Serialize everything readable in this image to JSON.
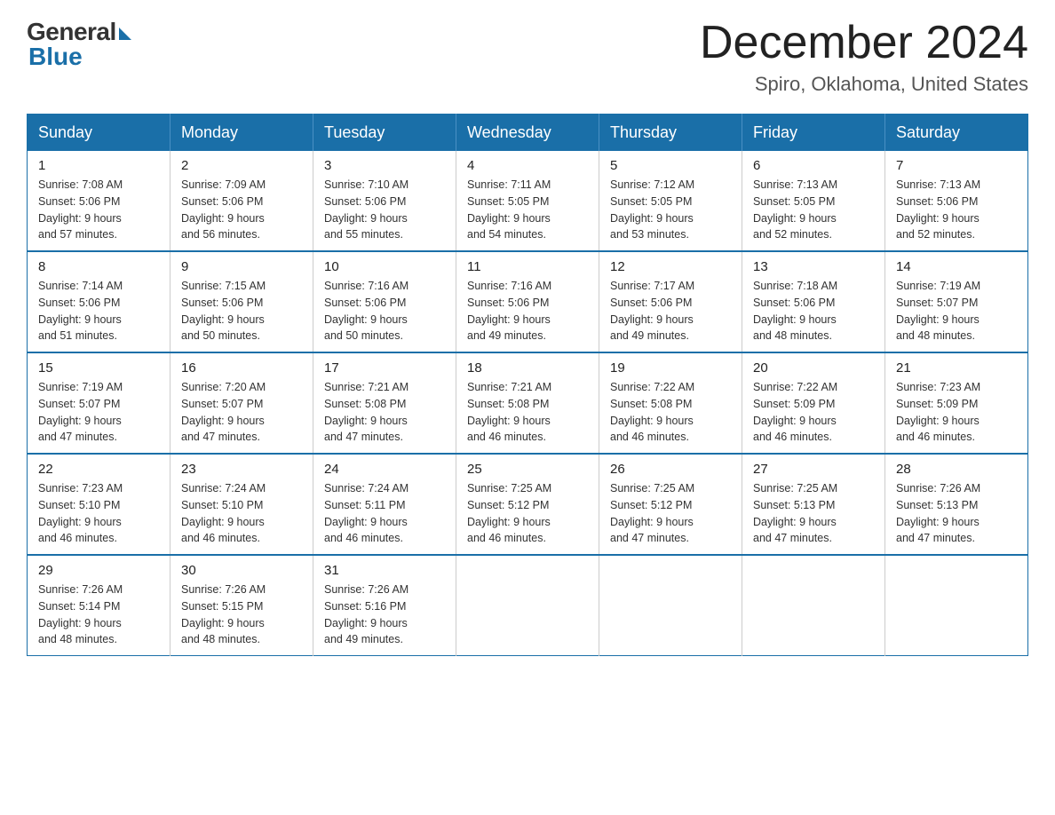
{
  "logo": {
    "general": "General",
    "blue": "Blue"
  },
  "title": {
    "month_year": "December 2024",
    "location": "Spiro, Oklahoma, United States"
  },
  "weekdays": [
    "Sunday",
    "Monday",
    "Tuesday",
    "Wednesday",
    "Thursday",
    "Friday",
    "Saturday"
  ],
  "weeks": [
    [
      {
        "day": "1",
        "sunrise": "7:08 AM",
        "sunset": "5:06 PM",
        "daylight": "9 hours and 57 minutes."
      },
      {
        "day": "2",
        "sunrise": "7:09 AM",
        "sunset": "5:06 PM",
        "daylight": "9 hours and 56 minutes."
      },
      {
        "day": "3",
        "sunrise": "7:10 AM",
        "sunset": "5:06 PM",
        "daylight": "9 hours and 55 minutes."
      },
      {
        "day": "4",
        "sunrise": "7:11 AM",
        "sunset": "5:05 PM",
        "daylight": "9 hours and 54 minutes."
      },
      {
        "day": "5",
        "sunrise": "7:12 AM",
        "sunset": "5:05 PM",
        "daylight": "9 hours and 53 minutes."
      },
      {
        "day": "6",
        "sunrise": "7:13 AM",
        "sunset": "5:05 PM",
        "daylight": "9 hours and 52 minutes."
      },
      {
        "day": "7",
        "sunrise": "7:13 AM",
        "sunset": "5:06 PM",
        "daylight": "9 hours and 52 minutes."
      }
    ],
    [
      {
        "day": "8",
        "sunrise": "7:14 AM",
        "sunset": "5:06 PM",
        "daylight": "9 hours and 51 minutes."
      },
      {
        "day": "9",
        "sunrise": "7:15 AM",
        "sunset": "5:06 PM",
        "daylight": "9 hours and 50 minutes."
      },
      {
        "day": "10",
        "sunrise": "7:16 AM",
        "sunset": "5:06 PM",
        "daylight": "9 hours and 50 minutes."
      },
      {
        "day": "11",
        "sunrise": "7:16 AM",
        "sunset": "5:06 PM",
        "daylight": "9 hours and 49 minutes."
      },
      {
        "day": "12",
        "sunrise": "7:17 AM",
        "sunset": "5:06 PM",
        "daylight": "9 hours and 49 minutes."
      },
      {
        "day": "13",
        "sunrise": "7:18 AM",
        "sunset": "5:06 PM",
        "daylight": "9 hours and 48 minutes."
      },
      {
        "day": "14",
        "sunrise": "7:19 AM",
        "sunset": "5:07 PM",
        "daylight": "9 hours and 48 minutes."
      }
    ],
    [
      {
        "day": "15",
        "sunrise": "7:19 AM",
        "sunset": "5:07 PM",
        "daylight": "9 hours and 47 minutes."
      },
      {
        "day": "16",
        "sunrise": "7:20 AM",
        "sunset": "5:07 PM",
        "daylight": "9 hours and 47 minutes."
      },
      {
        "day": "17",
        "sunrise": "7:21 AM",
        "sunset": "5:08 PM",
        "daylight": "9 hours and 47 minutes."
      },
      {
        "day": "18",
        "sunrise": "7:21 AM",
        "sunset": "5:08 PM",
        "daylight": "9 hours and 46 minutes."
      },
      {
        "day": "19",
        "sunrise": "7:22 AM",
        "sunset": "5:08 PM",
        "daylight": "9 hours and 46 minutes."
      },
      {
        "day": "20",
        "sunrise": "7:22 AM",
        "sunset": "5:09 PM",
        "daylight": "9 hours and 46 minutes."
      },
      {
        "day": "21",
        "sunrise": "7:23 AM",
        "sunset": "5:09 PM",
        "daylight": "9 hours and 46 minutes."
      }
    ],
    [
      {
        "day": "22",
        "sunrise": "7:23 AM",
        "sunset": "5:10 PM",
        "daylight": "9 hours and 46 minutes."
      },
      {
        "day": "23",
        "sunrise": "7:24 AM",
        "sunset": "5:10 PM",
        "daylight": "9 hours and 46 minutes."
      },
      {
        "day": "24",
        "sunrise": "7:24 AM",
        "sunset": "5:11 PM",
        "daylight": "9 hours and 46 minutes."
      },
      {
        "day": "25",
        "sunrise": "7:25 AM",
        "sunset": "5:12 PM",
        "daylight": "9 hours and 46 minutes."
      },
      {
        "day": "26",
        "sunrise": "7:25 AM",
        "sunset": "5:12 PM",
        "daylight": "9 hours and 47 minutes."
      },
      {
        "day": "27",
        "sunrise": "7:25 AM",
        "sunset": "5:13 PM",
        "daylight": "9 hours and 47 minutes."
      },
      {
        "day": "28",
        "sunrise": "7:26 AM",
        "sunset": "5:13 PM",
        "daylight": "9 hours and 47 minutes."
      }
    ],
    [
      {
        "day": "29",
        "sunrise": "7:26 AM",
        "sunset": "5:14 PM",
        "daylight": "9 hours and 48 minutes."
      },
      {
        "day": "30",
        "sunrise": "7:26 AM",
        "sunset": "5:15 PM",
        "daylight": "9 hours and 48 minutes."
      },
      {
        "day": "31",
        "sunrise": "7:26 AM",
        "sunset": "5:16 PM",
        "daylight": "9 hours and 49 minutes."
      },
      null,
      null,
      null,
      null
    ]
  ],
  "labels": {
    "sunrise": "Sunrise:",
    "sunset": "Sunset:",
    "daylight": "Daylight:"
  }
}
